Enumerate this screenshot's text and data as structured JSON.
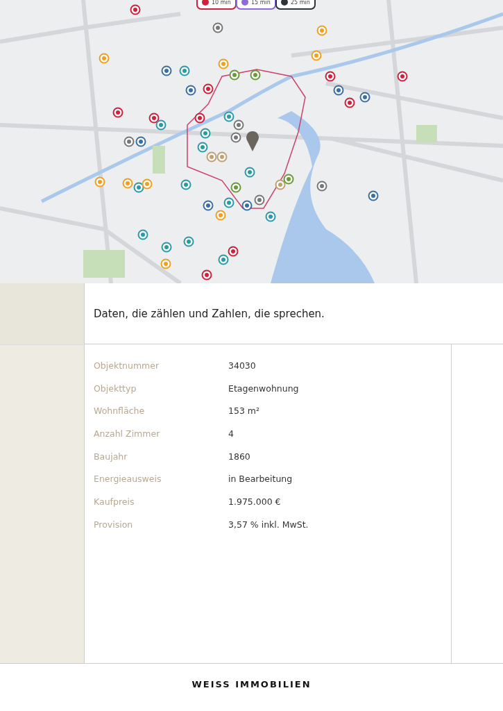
{
  "map": {
    "legend": [
      {
        "label": "10 min",
        "color": "#d0203c"
      },
      {
        "label": "15 min",
        "color": "#8e6bd6"
      },
      {
        "label": "25 min",
        "color": "#2e3338"
      }
    ]
  },
  "heading": "Daten, die zählen und Zahlen, die sprechen.",
  "facts": [
    {
      "label": "Objektnummer",
      "value": "34030"
    },
    {
      "label": "Objekttyp",
      "value": "Etagenwohnung"
    },
    {
      "label": "Wohnfläche",
      "value": "153 m²"
    },
    {
      "label": "Anzahl Zimmer",
      "value": "4"
    },
    {
      "label": "Baujahr",
      "value": "1860"
    },
    {
      "label": "Energieausweis",
      "value": "in Bearbeitung"
    },
    {
      "label": "Kaufpreis",
      "value": "1.975.000 €"
    },
    {
      "label": "Provision",
      "value": "3,57 % inkl. MwSt."
    }
  ],
  "footer": {
    "logo": "WEISS IMMOBILIEN"
  }
}
